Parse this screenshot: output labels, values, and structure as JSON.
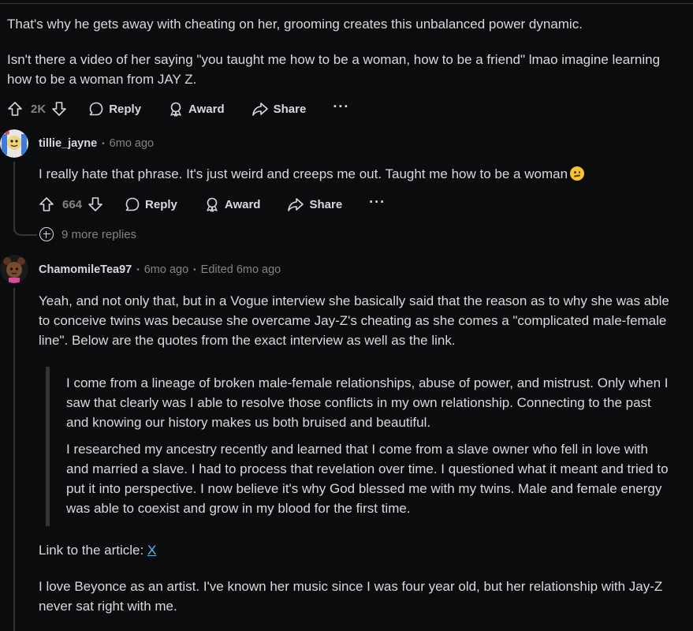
{
  "root_comment": {
    "paragraphs": [
      "That's why he gets away with cheating on her, grooming creates this unbalanced power dynamic.",
      "Isn't there a video of her saying \"you taught me how to be a woman, how to be a friend\" lmao imagine learning how to be a woman from JAY Z."
    ],
    "votes": "2K",
    "reply_label": "Reply",
    "award_label": "Award",
    "share_label": "Share",
    "more_label": "···"
  },
  "reply_1": {
    "username": "tillie_jayne",
    "time": "6mo ago",
    "text": "I really hate that phrase. It's just weird and creeps me out. Taught me how to be a woman",
    "emoji": "confused-face-emoji",
    "votes": "664",
    "reply_label": "Reply",
    "award_label": "Award",
    "share_label": "Share",
    "more_label": "···",
    "more_replies": "9 more replies"
  },
  "reply_2": {
    "username": "ChamomileTea97",
    "time": "6mo ago",
    "edited": "Edited 6mo ago",
    "intro": "Yeah, and not only that, but in a Vogue interview she basically said that the reason as to why she was able to conceive twins was because she overcame Jay-Z's cheating as she comes a \"complicated male-female line\". Below are the quotes from the exact interview as well as the link.",
    "quote_1": "I come from a lineage of broken male-female relationships, abuse of power, and mistrust. Only when I saw that clearly was I able to resolve those conflicts in my own relationship. Connecting to the past and knowing our history makes us both bruised and beautiful.",
    "quote_2": "I researched my ancestry recently and learned that I come from a slave owner who fell in love with and married a slave. I had to process that revelation over time. I questioned what it meant and tried to put it into perspective. I now believe it's why God blessed me with my twins. Male and female energy was able to coexist and grow in my blood for the first time.",
    "link_prefix": "Link to the article: ",
    "link_text": "X",
    "closing": "I love Beyonce as an artist. I've known her music since I was four year old, but her relationship with Jay-Z never sat right with me."
  },
  "colors": {
    "background": "#0b0c0d",
    "text": "#d7dadc",
    "muted": "#818384",
    "link": "#4fbcff",
    "thread_line": "#343536"
  }
}
